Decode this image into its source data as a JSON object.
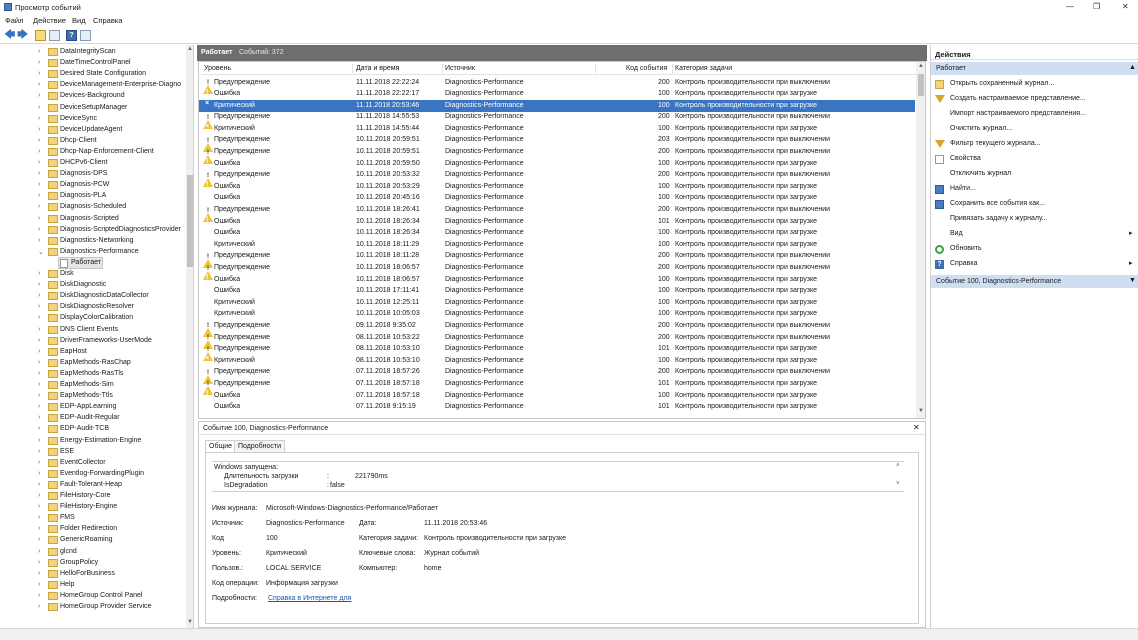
{
  "window": {
    "title": "Просмотр событий",
    "btn_min": "—",
    "btn_max": "❐",
    "btn_close": "✕"
  },
  "menu": [
    "Файл",
    "Действие",
    "Вид",
    "Справка"
  ],
  "toolbar": {
    "back": "🡄",
    "forward": "🡆",
    "help": "?"
  },
  "tree": {
    "items": [
      "DataIntegrityScan",
      "DateTimeControlPanel",
      "Desired State Configuration",
      "DeviceManagement-Enterprise-Diagno",
      "Devices-Background",
      "DeviceSetupManager",
      "DeviceSync",
      "DeviceUpdateAgent",
      "Dhcp-Client",
      "Dhcp-Nap-Enforcement-Client",
      "DHCPv6-Client",
      "Diagnosis-DPS",
      "Diagnosis-PCW",
      "Diagnosis-PLA",
      "Diagnosis-Scheduled",
      "Diagnosis-Scripted",
      "Diagnosis-ScriptedDiagnosticsProvider",
      "Diagnostics-Networking",
      "Diagnostics-Performance"
    ],
    "child": "Работает",
    "items_after": [
      "Disk",
      "DiskDiagnostic",
      "DiskDiagnosticDataCollector",
      "DiskDiagnosticResolver",
      "DisplayColorCalibration",
      "DNS Client Events",
      "DriverFrameworks-UserMode",
      "EapHost",
      "EapMethods-RasChap",
      "EapMethods-RasTls",
      "EapMethods-Sim",
      "EapMethods-Ttls",
      "EDP-AppLearning",
      "EDP-Audit-Regular",
      "EDP-Audit-TCB",
      "Energy-Estimation-Engine",
      "ESE",
      "EventCollector",
      "Eventlog-ForwardingPlugin",
      "Fault-Tolerant-Heap",
      "FileHistory-Core",
      "FileHistory-Engine",
      "FMS",
      "Folder Redirection",
      "GenericRoaming",
      "glcnd",
      "GroupPolicy",
      "HelloForBusiness",
      "Help",
      "HomeGroup Control Panel",
      "HomeGroup Provider Service"
    ]
  },
  "log": {
    "name": "Работает",
    "count_text": "Событий: 372"
  },
  "columns": {
    "level": "Уровень",
    "datetime": "Дата и время",
    "source": "Источник",
    "event_id": "Код события",
    "category": "Категория задачи"
  },
  "events": [
    {
      "level": "Предупреждение",
      "type": "warn",
      "datetime": "11.11.2018 22:22:24",
      "source": "Diagnostics-Performance",
      "id": "200",
      "category": "Контроль производительности при выключении"
    },
    {
      "level": "Ошибка",
      "type": "err",
      "datetime": "11.11.2018 22:22:17",
      "source": "Diagnostics-Performance",
      "id": "100",
      "category": "Контроль производительности при загрузке"
    },
    {
      "level": "Критический",
      "type": "crit",
      "datetime": "11.11.2018 20:53:46",
      "source": "Diagnostics-Performance",
      "id": "100",
      "category": "Контроль производительности при загрузке",
      "selected": true
    },
    {
      "level": "Предупреждение",
      "type": "warn",
      "datetime": "11.11.2018 14:55:53",
      "source": "Diagnostics-Performance",
      "id": "200",
      "category": "Контроль производительности при выключении"
    },
    {
      "level": "Критический",
      "type": "crit",
      "datetime": "11.11.2018 14:55:44",
      "source": "Diagnostics-Performance",
      "id": "100",
      "category": "Контроль производительности при загрузке"
    },
    {
      "level": "Предупреждение",
      "type": "warn",
      "datetime": "10.11.2018 20:59:51",
      "source": "Diagnostics-Performance",
      "id": "203",
      "category": "Контроль производительности при выключении"
    },
    {
      "level": "Предупреждение",
      "type": "warn",
      "datetime": "10.11.2018 20:59:51",
      "source": "Diagnostics-Performance",
      "id": "200",
      "category": "Контроль производительности при выключении"
    },
    {
      "level": "Ошибка",
      "type": "err",
      "datetime": "10.11.2018 20:59:50",
      "source": "Diagnostics-Performance",
      "id": "100",
      "category": "Контроль производительности при загрузке"
    },
    {
      "level": "Предупреждение",
      "type": "warn",
      "datetime": "10.11.2018 20:53:32",
      "source": "Diagnostics-Performance",
      "id": "200",
      "category": "Контроль производительности при выключении"
    },
    {
      "level": "Ошибка",
      "type": "err",
      "datetime": "10.11.2018 20:53:29",
      "source": "Diagnostics-Performance",
      "id": "100",
      "category": "Контроль производительности при загрузке"
    },
    {
      "level": "Ошибка",
      "type": "err",
      "datetime": "10.11.2018 20:45:16",
      "source": "Diagnostics-Performance",
      "id": "100",
      "category": "Контроль производительности при загрузке"
    },
    {
      "level": "Предупреждение",
      "type": "warn",
      "datetime": "10.11.2018 18:26:41",
      "source": "Diagnostics-Performance",
      "id": "200",
      "category": "Контроль производительности при выключении"
    },
    {
      "level": "Ошибка",
      "type": "err",
      "datetime": "10.11.2018 18:26:34",
      "source": "Diagnostics-Performance",
      "id": "101",
      "category": "Контроль производительности при загрузке"
    },
    {
      "level": "Ошибка",
      "type": "err",
      "datetime": "10.11.2018 18:26:34",
      "source": "Diagnostics-Performance",
      "id": "100",
      "category": "Контроль производительности при загрузке"
    },
    {
      "level": "Критический",
      "type": "crit",
      "datetime": "10.11.2018 18:11:29",
      "source": "Diagnostics-Performance",
      "id": "100",
      "category": "Контроль производительности при загрузке"
    },
    {
      "level": "Предупреждение",
      "type": "warn",
      "datetime": "10.11.2018 18:11:28",
      "source": "Diagnostics-Performance",
      "id": "200",
      "category": "Контроль производительности при выключении"
    },
    {
      "level": "Предупреждение",
      "type": "warn",
      "datetime": "10.11.2018 18:06:57",
      "source": "Diagnostics-Performance",
      "id": "200",
      "category": "Контроль производительности при выключении"
    },
    {
      "level": "Ошибка",
      "type": "err",
      "datetime": "10.11.2018 18:06:57",
      "source": "Diagnostics-Performance",
      "id": "100",
      "category": "Контроль производительности при загрузке"
    },
    {
      "level": "Ошибка",
      "type": "err",
      "datetime": "10.11.2018 17:11:41",
      "source": "Diagnostics-Performance",
      "id": "100",
      "category": "Контроль производительности при загрузке"
    },
    {
      "level": "Критический",
      "type": "crit",
      "datetime": "10.11.2018 12:25:11",
      "source": "Diagnostics-Performance",
      "id": "100",
      "category": "Контроль производительности при загрузке"
    },
    {
      "level": "Критический",
      "type": "crit",
      "datetime": "10.11.2018 10:05:03",
      "source": "Diagnostics-Performance",
      "id": "100",
      "category": "Контроль производительности при загрузке"
    },
    {
      "level": "Предупреждение",
      "type": "warn",
      "datetime": "09.11.2018 9:35:02",
      "source": "Diagnostics-Performance",
      "id": "200",
      "category": "Контроль производительности при выключении"
    },
    {
      "level": "Предупреждение",
      "type": "warn",
      "datetime": "08.11.2018 10:53:22",
      "source": "Diagnostics-Performance",
      "id": "200",
      "category": "Контроль производительности при выключении"
    },
    {
      "level": "Предупреждение",
      "type": "warn",
      "datetime": "08.11.2018 10:53:10",
      "source": "Diagnostics-Performance",
      "id": "101",
      "category": "Контроль производительности при загрузке"
    },
    {
      "level": "Критический",
      "type": "crit",
      "datetime": "08.11.2018 10:53:10",
      "source": "Diagnostics-Performance",
      "id": "100",
      "category": "Контроль производительности при загрузке"
    },
    {
      "level": "Предупреждение",
      "type": "warn",
      "datetime": "07.11.2018 18:57:26",
      "source": "Diagnostics-Performance",
      "id": "200",
      "category": "Контроль производительности при выключении"
    },
    {
      "level": "Предупреждение",
      "type": "warn",
      "datetime": "07.11.2018 18:57:18",
      "source": "Diagnostics-Performance",
      "id": "101",
      "category": "Контроль производительности при загрузке"
    },
    {
      "level": "Ошибка",
      "type": "err",
      "datetime": "07.11.2018 18:57:18",
      "source": "Diagnostics-Performance",
      "id": "100",
      "category": "Контроль производительности при загрузке"
    },
    {
      "level": "Ошибка",
      "type": "err",
      "datetime": "07.11.2018 9:15:19",
      "source": "Diagnostics-Performance",
      "id": "101",
      "category": "Контроль производительности при загрузке"
    }
  ],
  "detail": {
    "title": "Событие 100, Diagnostics-Performance",
    "tabs": [
      "Общие",
      "Подробности"
    ],
    "message_line1": "Windows запущена:",
    "message_line2_label": "Длительность загрузки",
    "message_line2_sep": ":",
    "message_line2_value": "221790ms",
    "message_line3_label": "IsDegradation",
    "message_line3_sep": ":",
    "message_line3_value": "false",
    "log_name_label": "Имя журнала:",
    "log_name": "Microsoft-Windows-Diagnostics-Performance/Работает",
    "source_label": "Источник:",
    "source": "Diagnostics-Performance",
    "date_label": "Дата:",
    "date": "11.11.2018 20:53:46",
    "code_label": "Код",
    "code": "100",
    "task_label": "Категория задачи:",
    "task": "Контроль производительности при загрузке",
    "level_label": "Уровень:",
    "level": "Критический",
    "keywords_label": "Ключевые слова:",
    "keywords": "Журнал событий",
    "user_label": "Пользов.:",
    "user": "LOCAL SERVICE",
    "computer_label": "Компьютер:",
    "computer": "home",
    "opcode_label": "Код операции:",
    "opcode": "Информация загрузки",
    "more_label": "Подробности:",
    "more_link": "Справка в Интернете для"
  },
  "actions": {
    "title": "Действия",
    "section1": "Работает",
    "items": [
      {
        "label": "Открыть сохраненный журнал...",
        "icon": "fold"
      },
      {
        "label": "Создать настраиваемое представление...",
        "icon": "funnel"
      },
      {
        "label": "Импорт настраиваемого представления...",
        "icon": "none"
      },
      {
        "label": "Очистить журнал...",
        "icon": "none"
      },
      {
        "label": "Фильтр текущего журнала...",
        "icon": "funnel"
      },
      {
        "label": "Свойства",
        "icon": "page"
      },
      {
        "label": "Отключить журнал",
        "icon": "none"
      },
      {
        "label": "Найти...",
        "icon": "blue"
      },
      {
        "label": "Сохранить все события как...",
        "icon": "blue"
      },
      {
        "label": "Привязать задачу к журналу...",
        "icon": "none"
      },
      {
        "label": "Вид",
        "icon": "none",
        "sub": true
      },
      {
        "label": "Обновить",
        "icon": "green"
      },
      {
        "label": "Справка",
        "icon": "help",
        "sub": true
      }
    ],
    "section2": "Событие 100, Diagnostics-Performance"
  }
}
